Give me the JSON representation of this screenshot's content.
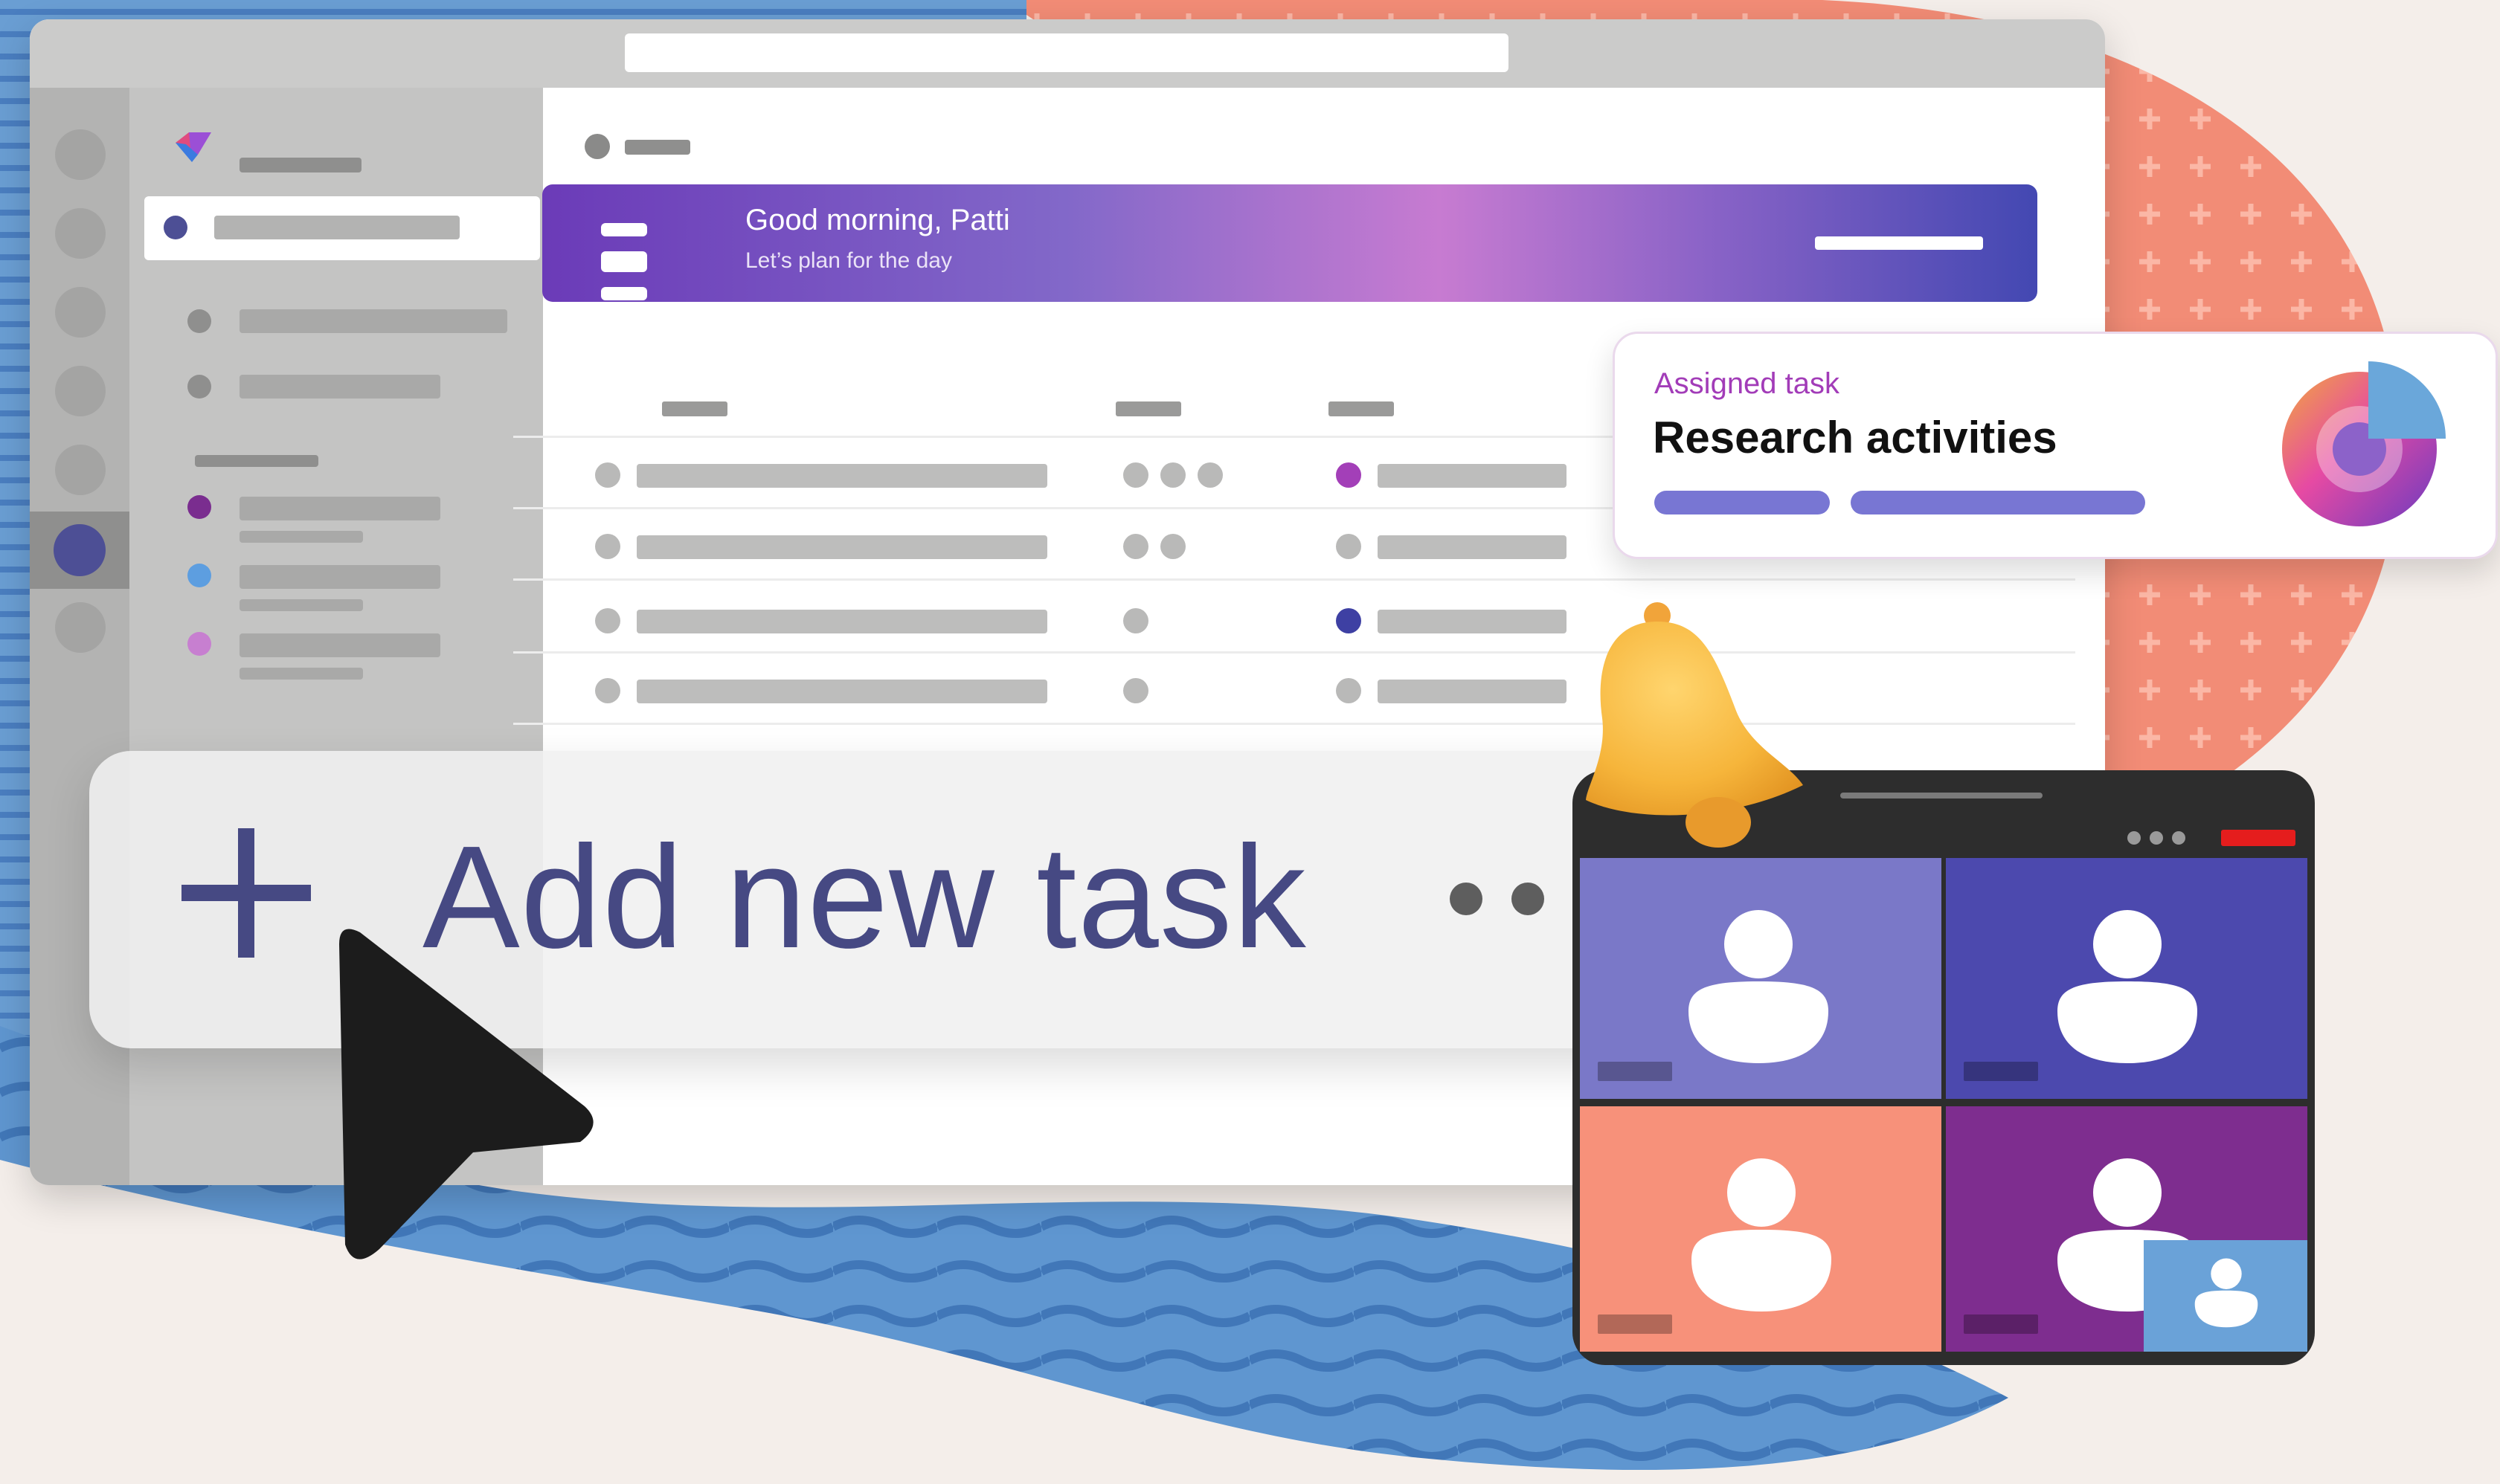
{
  "app": {
    "accent": "#6b3bb8",
    "brand_icon": "planner-logo-icon"
  },
  "greeting": {
    "title": "Good morning, Patti",
    "subtitle": "Let’s plan for the day"
  },
  "add_task": {
    "plus_icon": "plus-icon",
    "label": "Add new task",
    "more_icon": "more-horizontal-icon"
  },
  "assigned_card": {
    "kicker": "Assigned task",
    "title": "Research activities",
    "progress_icon": "progress-ring-icon"
  },
  "notification": {
    "icon": "bell-icon"
  },
  "video_call": {
    "tile_colors": [
      "#7a78c8",
      "#4c49ae",
      "#f7917a",
      "#7e2d8f"
    ],
    "self_view_color": "#6aa2d8",
    "end_call_color": "#e51d1d"
  },
  "pointer": {
    "icon": "cursor-arrow-icon"
  }
}
